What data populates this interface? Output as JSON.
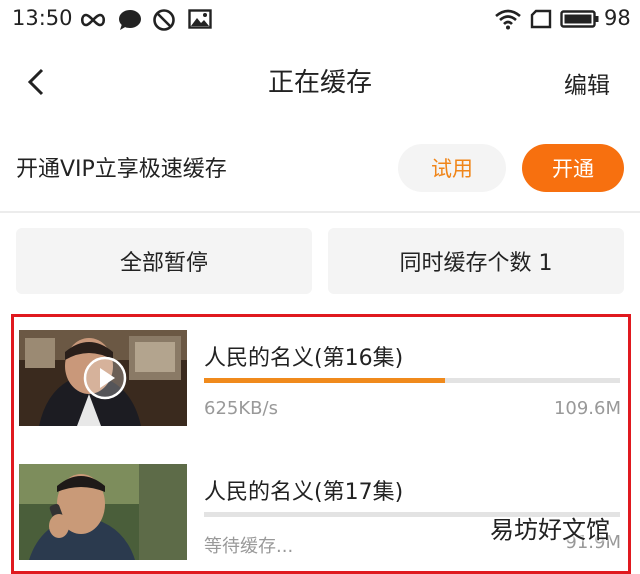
{
  "status_bar": {
    "time": "13:50",
    "battery_percent": "98",
    "icons": [
      "infinity-icon",
      "chat-bubble-icon",
      "do-not-disturb-icon",
      "image-icon",
      "wifi-icon",
      "sim-icon",
      "battery-icon"
    ]
  },
  "header": {
    "back_icon": "chevron-left-icon",
    "title": "正在缓存",
    "edit_label": "编辑"
  },
  "vip_banner": {
    "text": "开通VIP立享极速缓存",
    "trial_label": "试用",
    "open_label": "开通",
    "accent_color": "#f7700f"
  },
  "actions": {
    "pause_all_label": "全部暂停",
    "concurrent_label": "同时缓存个数 1"
  },
  "downloads": [
    {
      "title": "人民的名义(第16集)",
      "progress": 0.58,
      "speed": "625KB/s",
      "size": "109.6M",
      "thumb_icon": "play-icon"
    },
    {
      "title": "人民的名义(第17集)",
      "progress": 0,
      "speed": "等待缓存...",
      "size": "91.9M"
    }
  ],
  "watermark": "易坊好文馆",
  "colors": {
    "accent_orange": "#f7700f",
    "progress_orange": "#f08a1c",
    "highlight_red": "#e0191f"
  }
}
